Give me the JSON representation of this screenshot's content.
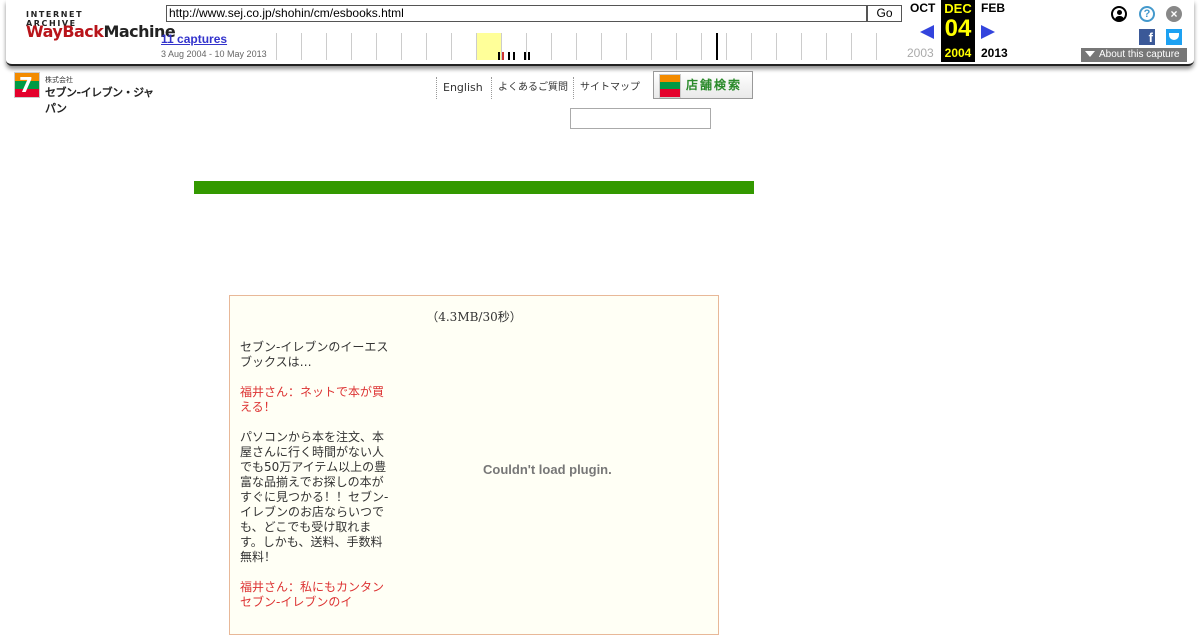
{
  "wayback": {
    "logo_top": "INTERNET ARCHIVE",
    "logo_way": "WayBack",
    "logo_machine": "Machine",
    "url": "http://www.sej.co.jp/shohin/cm/esbooks.html",
    "go_label": "Go",
    "captures": "11 captures",
    "date_range": "3 Aug 2004 - 10 May 2013",
    "prev_month": "OCT",
    "prev_year": "2003",
    "cur_month": "DEC",
    "cur_day": "04",
    "cur_year": "2004",
    "next_month": "FEB",
    "next_year": "2013",
    "about": "About this capture"
  },
  "header": {
    "company_small": "株式会社",
    "company_name": "セブン-イレブン・ジャパン",
    "logo_number": "7",
    "nav": [
      "English",
      "よくあるご質問",
      "サイトマップ"
    ],
    "store_search": "店舗検索"
  },
  "content": {
    "size_note": "（4.3MB/30秒）",
    "plugin_message": "Couldn't load plugin.",
    "paragraphs": [
      {
        "text": "セブン-イレブンのイーエスブックスは…",
        "red": false
      },
      {
        "text": "福井さん：ネットで本が買える！",
        "red": true
      },
      {
        "text": "パソコンから本を注文、本屋さんに行く時間がない人でも50万アイテム以上の豊富な品揃えでお探しの本がすぐに見つかる！！セブン-イレブンのお店ならいつでも、どこでも受け取れます。しかも、送料、手数料無料！",
        "red": false
      },
      {
        "text": "福井さん：私にもカンタン",
        "red": true
      },
      {
        "text": "セブン-イレブンのイ",
        "red": true
      }
    ]
  },
  "colors": {
    "green_bar": "#339900",
    "accent_red": "#dd3333",
    "wayback_yellow": "#ffff00"
  }
}
